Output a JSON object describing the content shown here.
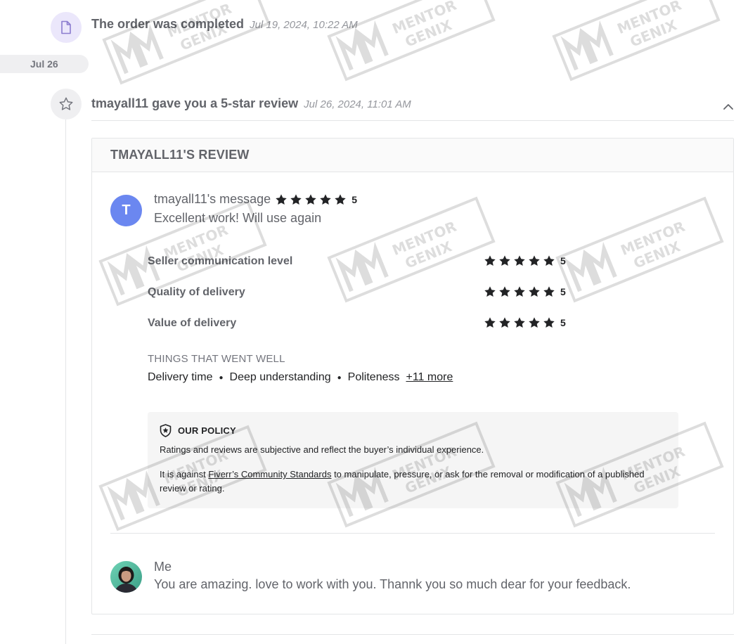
{
  "timeline": {
    "order_event": {
      "icon": "document-icon",
      "title": "The order was completed",
      "time": "Jul 19, 2024, 10:22 AM"
    },
    "date_separator": "Jul 26",
    "review_event": {
      "icon": "star-outline-icon",
      "title": "tmayall11 gave you a 5-star review",
      "time": "Jul 26, 2024, 11:01 AM",
      "collapse_icon": "chevron-up-icon"
    }
  },
  "review": {
    "header": "TMAYALL11'S REVIEW",
    "buyer": {
      "avatar_letter": "T",
      "avatar_color": "#6b87f0",
      "label": "tmayall11's message",
      "score": "5",
      "message": "Excellent work! Will use again"
    },
    "ratings": [
      {
        "label": "Seller communication level",
        "score": "5"
      },
      {
        "label": "Quality of delivery",
        "score": "5"
      },
      {
        "label": "Value of delivery",
        "score": "5"
      }
    ],
    "went_well": {
      "title": "THINGS THAT WENT WELL",
      "items": [
        "Delivery time",
        "Deep understanding",
        "Politeness"
      ],
      "more": "+11 more"
    },
    "policy": {
      "icon": "shield-star-icon",
      "title": "OUR POLICY",
      "line1": "Ratings and reviews are subjective and reflect the buyer’s individual experience.",
      "line2_before": "It is against ",
      "line2_link": "Fiverr’s Community Standards",
      "line2_after": " to manipulate, pressure, or ask for the removal or modification of a published review or rating."
    },
    "seller_reply": {
      "name": "Me",
      "message": "You are amazing. love to work with you. Thannk you so much dear for your feedback."
    }
  },
  "watermark_text": [
    "MENTOR",
    "GENIX"
  ]
}
